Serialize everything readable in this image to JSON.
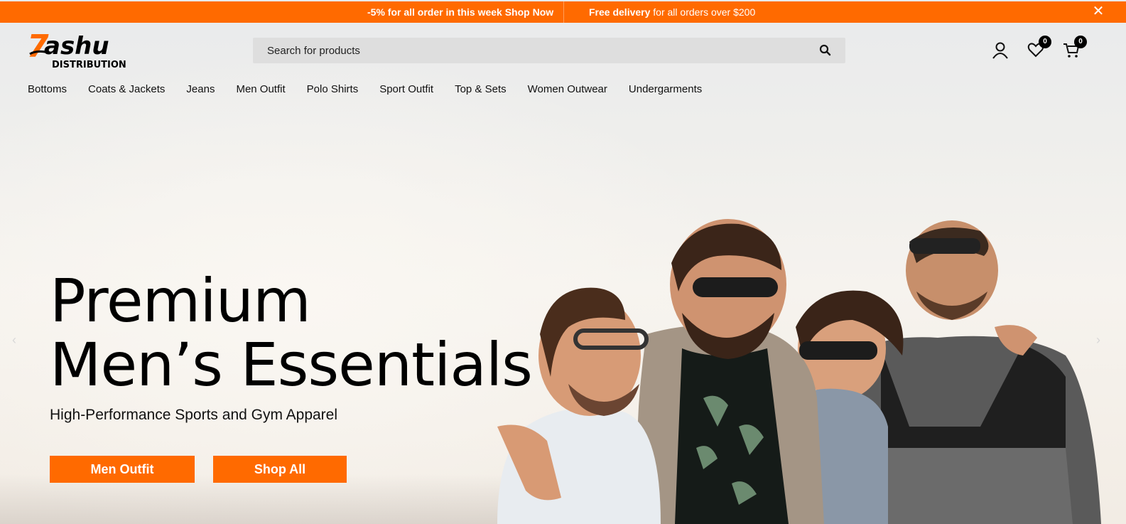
{
  "announcement": {
    "offer_prefix": "-5% for all order in this week ",
    "offer_link": "Shop Now",
    "delivery_bold": "Free delivery",
    "delivery_rest": " for all orders over $200",
    "close_glyph": "✕"
  },
  "brand": {
    "logo_text_top": "ashu",
    "logo_text_bottom": "DISTRIBUTION",
    "logo_mark": "7",
    "accent_color": "#ff6a00"
  },
  "search": {
    "placeholder": "Search for products",
    "icon": "search-icon"
  },
  "header_icons": {
    "account": "user-icon",
    "wishlist": "heart-icon",
    "wishlist_count": "0",
    "cart": "cart-icon",
    "cart_count": "0"
  },
  "nav": {
    "items": [
      "Bottoms",
      "Coats & Jackets",
      "Jeans",
      "Men Outfit",
      "Polo Shirts",
      "Sport Outfit",
      "Top & Sets",
      "Women Outwear",
      "Undergarments"
    ]
  },
  "hero": {
    "title_line1": "Premium",
    "title_line2": "Men’s Essentials",
    "subtitle": "High-Performance Sports and Gym Apparel",
    "button_primary": "Men Outfit",
    "button_secondary": "Shop All",
    "prev_arrow": "‹",
    "next_arrow": "›"
  }
}
